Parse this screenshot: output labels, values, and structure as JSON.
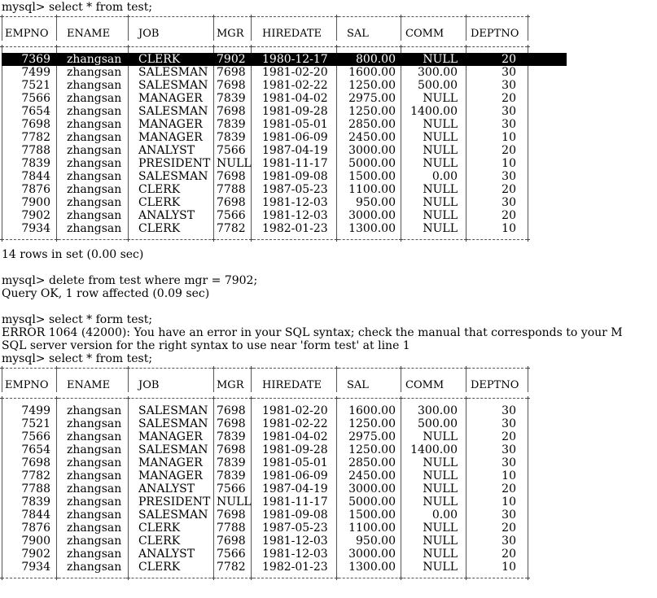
{
  "terminal": {
    "cmd1": "mysql> select * from test;",
    "rows_msg": "14 rows in set (0.00 sec)",
    "cmd2": "mysql> delete from test where mgr = 7902;",
    "query_ok": "Query OK, 1 row affected (0.09 sec)",
    "cmd3": "mysql> select * form test;",
    "error_line1": "ERROR 1064 (42000): You have an error in your SQL syntax; check the manual that corresponds to your M",
    "error_line2": "SQL server version for the right syntax to use near 'form test' at line 1",
    "cmd4": "mysql> select * from test;"
  },
  "table": {
    "columns": [
      "EMPNO",
      "ENAME",
      "JOB",
      "MGR",
      "HIREDATE",
      "SAL",
      "COMM",
      "DEPTNO"
    ]
  },
  "table1": {
    "rows": [
      [
        "7369",
        "zhangsan",
        "CLERK",
        "7902",
        "1980-12-17",
        "800.00",
        "NULL",
        "20"
      ],
      [
        "7499",
        "zhangsan",
        "SALESMAN",
        "7698",
        "1981-02-20",
        "1600.00",
        "300.00",
        "30"
      ],
      [
        "7521",
        "zhangsan",
        "SALESMAN",
        "7698",
        "1981-02-22",
        "1250.00",
        "500.00",
        "30"
      ],
      [
        "7566",
        "zhangsan",
        "MANAGER",
        "7839",
        "1981-04-02",
        "2975.00",
        "NULL",
        "20"
      ],
      [
        "7654",
        "zhangsan",
        "SALESMAN",
        "7698",
        "1981-09-28",
        "1250.00",
        "1400.00",
        "30"
      ],
      [
        "7698",
        "zhangsan",
        "MANAGER",
        "7839",
        "1981-05-01",
        "2850.00",
        "NULL",
        "30"
      ],
      [
        "7782",
        "zhangsan",
        "MANAGER",
        "7839",
        "1981-06-09",
        "2450.00",
        "NULL",
        "10"
      ],
      [
        "7788",
        "zhangsan",
        "ANALYST",
        "7566",
        "1987-04-19",
        "3000.00",
        "NULL",
        "20"
      ],
      [
        "7839",
        "zhangsan",
        "PRESIDENT",
        "NULL",
        "1981-11-17",
        "5000.00",
        "NULL",
        "10"
      ],
      [
        "7844",
        "zhangsan",
        "SALESMAN",
        "7698",
        "1981-09-08",
        "1500.00",
        "0.00",
        "30"
      ],
      [
        "7876",
        "zhangsan",
        "CLERK",
        "7788",
        "1987-05-23",
        "1100.00",
        "NULL",
        "20"
      ],
      [
        "7900",
        "zhangsan",
        "CLERK",
        "7698",
        "1981-12-03",
        "950.00",
        "NULL",
        "30"
      ],
      [
        "7902",
        "zhangsan",
        "ANALYST",
        "7566",
        "1981-12-03",
        "3000.00",
        "NULL",
        "20"
      ],
      [
        "7934",
        "zhangsan",
        "CLERK",
        "7782",
        "1982-01-23",
        "1300.00",
        "NULL",
        "10"
      ]
    ]
  },
  "table2": {
    "rows": [
      [
        "7499",
        "zhangsan",
        "SALESMAN",
        "7698",
        "1981-02-20",
        "1600.00",
        "300.00",
        "30"
      ],
      [
        "7521",
        "zhangsan",
        "SALESMAN",
        "7698",
        "1981-02-22",
        "1250.00",
        "500.00",
        "30"
      ],
      [
        "7566",
        "zhangsan",
        "MANAGER",
        "7839",
        "1981-04-02",
        "2975.00",
        "NULL",
        "20"
      ],
      [
        "7654",
        "zhangsan",
        "SALESMAN",
        "7698",
        "1981-09-28",
        "1250.00",
        "1400.00",
        "30"
      ],
      [
        "7698",
        "zhangsan",
        "MANAGER",
        "7839",
        "1981-05-01",
        "2850.00",
        "NULL",
        "30"
      ],
      [
        "7782",
        "zhangsan",
        "MANAGER",
        "7839",
        "1981-06-09",
        "2450.00",
        "NULL",
        "10"
      ],
      [
        "7788",
        "zhangsan",
        "ANALYST",
        "7566",
        "1987-04-19",
        "3000.00",
        "NULL",
        "20"
      ],
      [
        "7839",
        "zhangsan",
        "PRESIDENT",
        "NULL",
        "1981-11-17",
        "5000.00",
        "NULL",
        "10"
      ],
      [
        "7844",
        "zhangsan",
        "SALESMAN",
        "7698",
        "1981-09-08",
        "1500.00",
        "0.00",
        "30"
      ],
      [
        "7876",
        "zhangsan",
        "CLERK",
        "7788",
        "1987-05-23",
        "1100.00",
        "NULL",
        "20"
      ],
      [
        "7900",
        "zhangsan",
        "CLERK",
        "7698",
        "1981-12-03",
        "950.00",
        "NULL",
        "30"
      ],
      [
        "7902",
        "zhangsan",
        "ANALYST",
        "7566",
        "1981-12-03",
        "3000.00",
        "NULL",
        "20"
      ],
      [
        "7934",
        "zhangsan",
        "CLERK",
        "7782",
        "1982-01-23",
        "1300.00",
        "NULL",
        "10"
      ]
    ]
  }
}
